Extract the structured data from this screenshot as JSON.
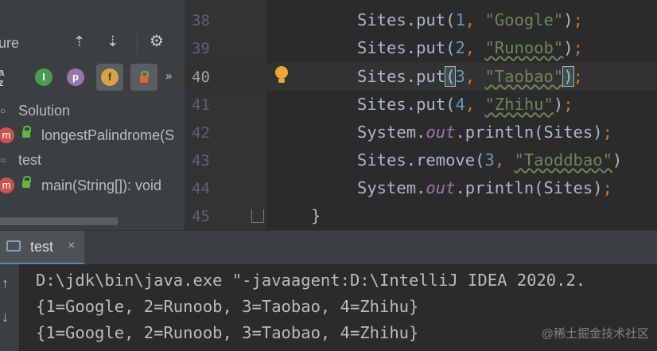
{
  "structure": {
    "title_fragment": "ure",
    "tree": [
      {
        "label": "Solution"
      },
      {
        "label": "longestPalindrome(S"
      },
      {
        "label": "test"
      },
      {
        "label": "main(String[]): void"
      }
    ],
    "badges": {
      "interface": "I",
      "property": "p",
      "field": "f",
      "method": "m"
    }
  },
  "editor": {
    "line_numbers": [
      "38",
      "39",
      "40",
      "41",
      "42",
      "43",
      "44",
      "45"
    ],
    "lines": {
      "l38": {
        "obj": "Sites",
        "dot": ".",
        "method": "put",
        "open": "(",
        "num": "1",
        "comma": ", ",
        "str": "\"Google\"",
        "close": ")",
        "semi": ";"
      },
      "l39": {
        "obj": "Sites",
        "dot": ".",
        "method": "put",
        "open": "(",
        "num": "2",
        "comma": ", ",
        "str": "\"Runoob\"",
        "close": ")",
        "semi": ";"
      },
      "l40": {
        "obj": "Sites",
        "dot": ".",
        "method": "put",
        "open": "(",
        "num": "3",
        "comma": ", ",
        "str": "\"Taobao\"",
        "close": ")",
        "semi": ";"
      },
      "l41": {
        "obj": "Sites",
        "dot": ".",
        "method": "put",
        "open": "(",
        "num": "4",
        "comma": ", ",
        "str": "\"Zhihu\"",
        "close": ")",
        "semi": ";"
      },
      "l42": {
        "pre": "System.",
        "field": "out",
        "post": ".println(Sites)",
        "semi": ";"
      },
      "l43": {
        "obj": "Sites",
        "dot": ".",
        "method": "remove",
        "open": "(",
        "num": "3",
        "comma": ", ",
        "str": "\"Taoddbao\"",
        "close": ")"
      },
      "l44": {
        "pre": "System.",
        "field": "out",
        "post": ".println(Sites)",
        "semi": ";"
      },
      "l45": {
        "brace": "}"
      }
    }
  },
  "run": {
    "tab_label": "test",
    "close": "×",
    "output": [
      "D:\\jdk\\bin\\java.exe \"-javaagent:D:\\IntelliJ IDEA 2020.2.",
      "{1=Google, 2=Runoob, 3=Taobao, 4=Zhihu}",
      "{1=Google, 2=Runoob, 3=Taobao, 4=Zhihu}"
    ]
  },
  "watermark": "@稀土掘金技术社区",
  "colors": {
    "keyword": "#cc7832",
    "number": "#6897bb",
    "string": "#6a8759",
    "field": "#9876aa",
    "text": "#a9b7c6",
    "method_badge": "#c75450",
    "lock": "#62b543"
  },
  "icons": [
    "expand-all-icon",
    "collapse-all-icon",
    "gear-icon",
    "sort-alpha-icon",
    "show-inherited-icon",
    "show-properties-icon",
    "show-fields-icon",
    "show-non-public-icon",
    "more-chevron-icon",
    "lightbulb-icon",
    "fold-icon",
    "rerun-icon",
    "scroll-down-icon"
  ]
}
